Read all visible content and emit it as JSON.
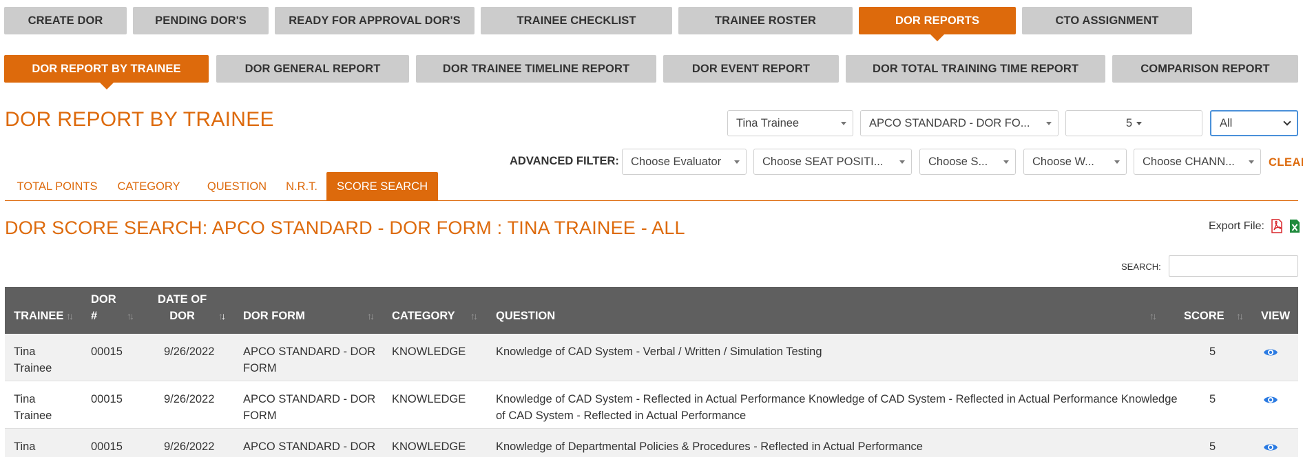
{
  "top_tabs": [
    {
      "label": "CREATE DOR",
      "active": false
    },
    {
      "label": "PENDING DOR'S",
      "active": false
    },
    {
      "label": "READY FOR APPROVAL DOR'S",
      "active": false
    },
    {
      "label": "TRAINEE CHECKLIST",
      "active": false
    },
    {
      "label": "TRAINEE ROSTER",
      "active": false
    },
    {
      "label": "DOR REPORTS",
      "active": true
    },
    {
      "label": "CTO ASSIGNMENT",
      "active": false
    }
  ],
  "report_tabs": [
    {
      "label": "DOR REPORT BY TRAINEE",
      "active": true
    },
    {
      "label": "DOR GENERAL REPORT",
      "active": false
    },
    {
      "label": "DOR TRAINEE TIMELINE REPORT",
      "active": false
    },
    {
      "label": "DOR EVENT REPORT",
      "active": false
    },
    {
      "label": "DOR TOTAL TRAINING TIME REPORT",
      "active": false
    },
    {
      "label": "COMPARISON REPORT",
      "active": false
    }
  ],
  "page_title": "DOR REPORT BY TRAINEE",
  "filters": {
    "trainee": "Tina Trainee",
    "form": "APCO STANDARD - DOR FO...",
    "count": "5",
    "period": "All"
  },
  "advanced_filter": {
    "label": "ADVANCED FILTER:",
    "evaluator": "Choose Evaluator",
    "seat_position": "Choose SEAT POSITI...",
    "s": "Choose S...",
    "w": "Choose W...",
    "channel": "Choose CHANN...",
    "clear": "CLEAR"
  },
  "sub_tabs": [
    {
      "label": "TOTAL POINTS",
      "active": false
    },
    {
      "label": "CATEGORY",
      "active": false
    },
    {
      "label": "QUESTION",
      "active": false
    },
    {
      "label": "N.R.T.",
      "active": false
    },
    {
      "label": "SCORE SEARCH",
      "active": true
    }
  ],
  "report_title": "DOR SCORE SEARCH: APCO STANDARD - DOR FORM : TINA TRAINEE - ALL",
  "export_label": "Export File:",
  "search_label": "SEARCH:",
  "table": {
    "headers": {
      "trainee": "TRAINEE",
      "dor_num_1": "DOR",
      "dor_num_2": "#",
      "date_1": "DATE OF",
      "date_2": "DOR",
      "form": "DOR FORM",
      "category": "CATEGORY",
      "question": "QUESTION",
      "score": "SCORE",
      "view": "VIEW"
    },
    "rows": [
      {
        "trainee_1": "Tina",
        "trainee_2": "Trainee",
        "dor": "00015",
        "date": "9/26/2022",
        "form_1": "APCO STANDARD - DOR",
        "form_2": "FORM",
        "category": "KNOWLEDGE",
        "question_1": "Knowledge of CAD System - Verbal / Written / Simulation Testing",
        "question_2": "",
        "score": "5"
      },
      {
        "trainee_1": "Tina",
        "trainee_2": "Trainee",
        "dor": "00015",
        "date": "9/26/2022",
        "form_1": "APCO STANDARD - DOR",
        "form_2": "FORM",
        "category": "KNOWLEDGE",
        "question_1": "Knowledge of CAD System - Reflected in Actual Performance Knowledge of CAD System - Reflected in Actual Performance Knowledge",
        "question_2": "of CAD System - Reflected in Actual Performance",
        "score": "5"
      },
      {
        "trainee_1": "Tina",
        "trainee_2": "",
        "dor": "00015",
        "date": "9/26/2022",
        "form_1": "APCO STANDARD - DOR",
        "form_2": "",
        "category": "KNOWLEDGE",
        "question_1": "Knowledge of Departmental Policies & Procedures - Reflected in Actual Performance",
        "question_2": "",
        "score": "5"
      }
    ]
  },
  "colors": {
    "accent": "#dd6a0c",
    "tab_inactive": "#cccccc",
    "table_header": "#5f5f5f",
    "view_icon": "#2a7ae2",
    "pdf_icon": "#d9262c",
    "excel_icon": "#1f8a3c"
  }
}
